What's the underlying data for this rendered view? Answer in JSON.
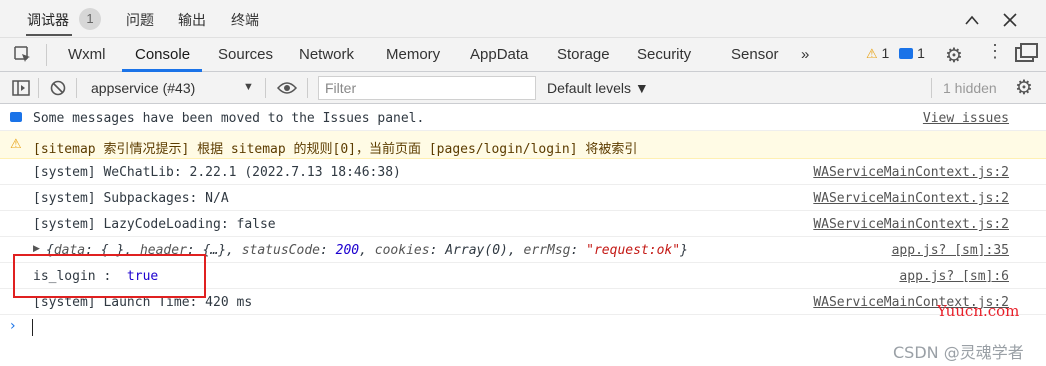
{
  "top_tabs": {
    "debugger": "调试器",
    "badge": "1",
    "issues": "问题",
    "output": "输出",
    "terminal": "终端"
  },
  "panel_tabs": [
    "Wxml",
    "Console",
    "Sources",
    "Network",
    "Memory",
    "AppData",
    "Storage",
    "Security",
    "Sensor",
    "»"
  ],
  "status": {
    "warnings": "1",
    "infos": "1"
  },
  "toolbar": {
    "context": "appservice (#43)",
    "filter_placeholder": "Filter",
    "levels": "Default levels ▼",
    "hidden": "1 hidden"
  },
  "messages": [
    {
      "type": "info",
      "text": "Some messages have been moved to the Issues panel.",
      "source": "View issues"
    },
    {
      "type": "warning",
      "text": "[sitemap 索引情况提示] 根据 sitemap 的规则[0]，当前页面 [pages/login/login] 将被索引",
      "source": ""
    },
    {
      "type": "log",
      "text": "[system] WeChatLib: 2.22.1 (2022.7.13 18:46:38)",
      "source": "WAServiceMainContext.js:2"
    },
    {
      "type": "log",
      "text": "[system] Subpackages: N/A",
      "source": "WAServiceMainContext.js:2"
    },
    {
      "type": "log",
      "text": "[system] LazyCodeLoading: false",
      "source": "WAServiceMainContext.js:2"
    },
    {
      "type": "object",
      "source": "app.js? [sm]:35",
      "parts": {
        "open": "{",
        "k1": "data",
        "v1": "{ }",
        "k2": "header",
        "v2": "{…}",
        "k3": "statusCode",
        "v3": "200",
        "k4": "cookies",
        "v4": "Array(0)",
        "k5": "errMsg",
        "v5": "\"request:ok\"",
        "close": "}"
      }
    },
    {
      "type": "log",
      "text": "is_login :  ",
      "value": "true",
      "source": "app.js? [sm]:6"
    },
    {
      "type": "log",
      "text": "[system] Launch Time: 420 ms",
      "source": "WAServiceMainContext.js:2"
    }
  ],
  "watermarks": {
    "site": "Yuucn.com",
    "author": "CSDN @灵魂学者"
  }
}
